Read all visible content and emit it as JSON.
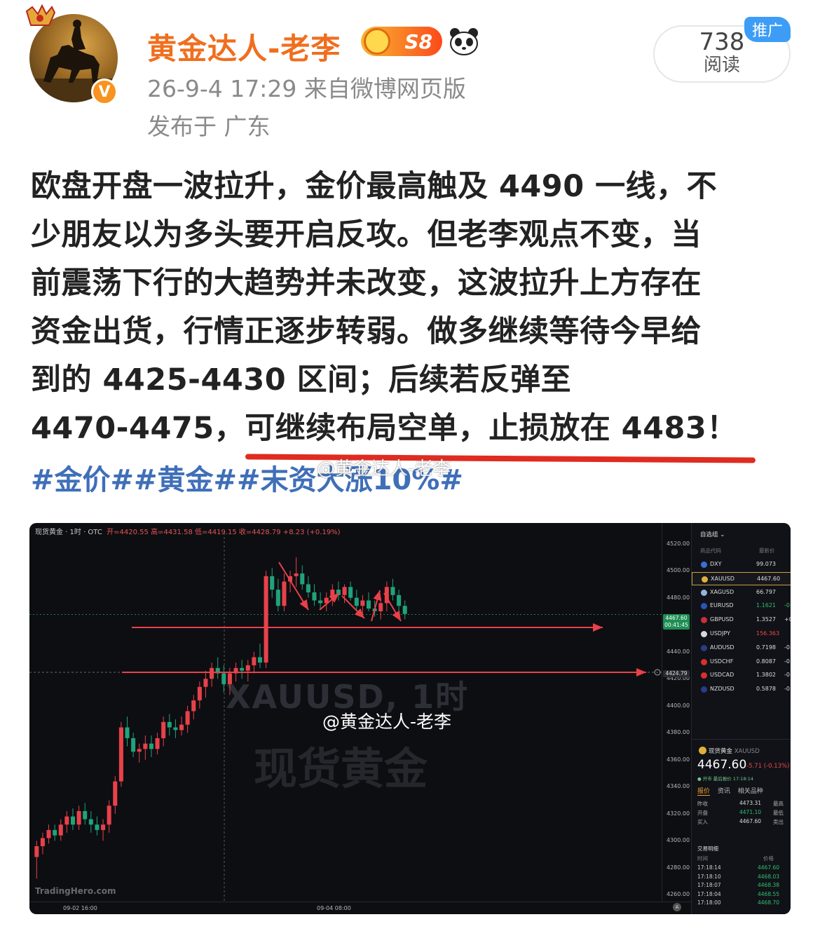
{
  "author": {
    "name": "黄金达人-老李",
    "badge_level": "S8",
    "verified_mark": "V"
  },
  "post_meta": {
    "time_source": "26-9-4 17:29  来自微博网页版",
    "location": "发布于 广东"
  },
  "stats": {
    "reads_count": "738",
    "reads_label": "阅读",
    "promo_label": "推广"
  },
  "post": {
    "lines": [
      "欧盘开盘一波拉升，金价最高触及 4490 一线，不",
      "少朋友以为多头要开启反攻。但老李观点不变，当",
      "前震荡下行的大趋势并未改变，这波拉升上方存在",
      "资金出货，行情正逐步转弱。做多继续等待今早给",
      "到的 4425-4430 区间；后续若反弹至",
      "4470-4475，可继续布局空单，止损放在 4483！"
    ],
    "hashtags": "#金价##黄金##末资大涨10%#",
    "watermark": "@黄金达人-老李"
  },
  "chart": {
    "header_symbol": "现货黄金 · 1时 · OTC",
    "header_ohlc": "开=4420.55  高=4431.58  低=4419.15  收=4428.79  +8.23 (+0.19%)",
    "yticks": [
      "4520.00",
      "4500.00",
      "4480.00",
      "4440.00",
      "4420.00",
      "4400.00",
      "4380.00",
      "4360.00",
      "4340.00",
      "4320.00",
      "4300.00",
      "4280.00",
      "4260.00"
    ],
    "xticks": [
      "09-02 16:00",
      "09-04 08:00"
    ],
    "price_tag_last": "4467.60",
    "price_tag_time": "00:41:45",
    "price_tag_cross": "4424.79",
    "watermark_symbol": "XAUUSD, 1时",
    "watermark_name": "现货黄金",
    "watermark_user": "@黄金达人-老李",
    "brand": "TradingHero.com",
    "axis_btn": "A"
  },
  "chart_data": {
    "type": "candlestick",
    "title": "现货黄金 · 1时 · OTC",
    "ylim": [
      4255,
      4525
    ],
    "candles": [
      [
        4288,
        4300,
        4272,
        4296
      ],
      [
        4296,
        4306,
        4290,
        4302
      ],
      [
        4302,
        4312,
        4298,
        4308
      ],
      [
        4308,
        4312,
        4300,
        4304
      ],
      [
        4304,
        4316,
        4300,
        4312
      ],
      [
        4312,
        4322,
        4306,
        4318
      ],
      [
        4318,
        4324,
        4308,
        4312
      ],
      [
        4312,
        4326,
        4308,
        4322
      ],
      [
        4322,
        4328,
        4312,
        4316
      ],
      [
        4316,
        4322,
        4306,
        4312
      ],
      [
        4312,
        4318,
        4304,
        4308
      ],
      [
        4308,
        4316,
        4300,
        4312
      ],
      [
        4312,
        4330,
        4306,
        4326
      ],
      [
        4326,
        4348,
        4320,
        4344
      ],
      [
        4344,
        4388,
        4340,
        4384
      ],
      [
        4384,
        4392,
        4370,
        4376
      ],
      [
        4376,
        4380,
        4362,
        4366
      ],
      [
        4366,
        4372,
        4358,
        4368
      ],
      [
        4368,
        4378,
        4360,
        4372
      ],
      [
        4372,
        4378,
        4362,
        4368
      ],
      [
        4368,
        4380,
        4364,
        4376
      ],
      [
        4376,
        4392,
        4370,
        4388
      ],
      [
        4388,
        4394,
        4378,
        4384
      ],
      [
        4384,
        4390,
        4376,
        4382
      ],
      [
        4382,
        4392,
        4378,
        4386
      ],
      [
        4386,
        4400,
        4380,
        4396
      ],
      [
        4396,
        4408,
        4390,
        4404
      ],
      [
        4404,
        4418,
        4398,
        4414
      ],
      [
        4414,
        4426,
        4406,
        4420
      ],
      [
        4420,
        4432,
        4414,
        4428
      ],
      [
        4428,
        4436,
        4420,
        4424
      ],
      [
        4424,
        4430,
        4410,
        4416
      ],
      [
        4416,
        4428,
        4408,
        4424
      ],
      [
        4424,
        4432,
        4418,
        4428
      ],
      [
        4428,
        4434,
        4420,
        4426
      ],
      [
        4426,
        4434,
        4418,
        4430
      ],
      [
        4430,
        4440,
        4424,
        4436
      ],
      [
        4436,
        4446,
        4428,
        4432
      ],
      [
        4432,
        4500,
        4428,
        4496
      ],
      [
        4496,
        4502,
        4480,
        4486
      ],
      [
        4486,
        4494,
        4470,
        4474
      ],
      [
        4474,
        4498,
        4470,
        4492
      ],
      [
        4492,
        4500,
        4484,
        4496
      ],
      [
        4496,
        4510,
        4488,
        4498
      ],
      [
        4498,
        4504,
        4486,
        4490
      ],
      [
        4490,
        4496,
        4480,
        4484
      ],
      [
        4484,
        4490,
        4474,
        4478
      ],
      [
        4478,
        4484,
        4472,
        4476
      ],
      [
        4476,
        4484,
        4470,
        4480
      ],
      [
        4480,
        4490,
        4474,
        4486
      ],
      [
        4486,
        4492,
        4478,
        4482
      ],
      [
        4482,
        4490,
        4476,
        4488
      ],
      [
        4488,
        4492,
        4478,
        4480
      ],
      [
        4480,
        4486,
        4470,
        4474
      ],
      [
        4474,
        4482,
        4466,
        4478
      ],
      [
        4478,
        4484,
        4470,
        4472
      ],
      [
        4472,
        4478,
        4466,
        4470
      ],
      [
        4470,
        4480,
        4464,
        4476
      ],
      [
        4476,
        4492,
        4470,
        4488
      ],
      [
        4488,
        4494,
        4478,
        4482
      ],
      [
        4482,
        4486,
        4470,
        4474
      ],
      [
        4474,
        4478,
        4464,
        4468
      ]
    ],
    "levels": [
      4458,
      4424.79
    ],
    "last_price": 4467.6
  },
  "watchlist": {
    "title": "自选组",
    "col_code": "商品代码",
    "col_price": "最新价",
    "rows": [
      {
        "sym": "DXY",
        "price": "99.073",
        "chg": "",
        "dir": "wh",
        "flag": "#3b6fd8"
      },
      {
        "sym": "XAUUSD",
        "price": "4467.60",
        "chg": "",
        "dir": "wh",
        "flag": "#e0b03a",
        "selected": true
      },
      {
        "sym": "XAGUSD",
        "price": "66.797",
        "chg": "",
        "dir": "wh",
        "flag": "#8fb8d8"
      },
      {
        "sym": "EURUSD",
        "price": "1.1621",
        "chg": "-0",
        "dir": "up",
        "flag": "#2a54b8"
      },
      {
        "sym": "GBPUSD",
        "price": "1.3527",
        "chg": "+0",
        "dir": "wh",
        "flag": "#c8303a"
      },
      {
        "sym": "USDJPY",
        "price": "156.363",
        "chg": "",
        "dir": "dn",
        "flag": "#d8d8e0"
      },
      {
        "sym": "AUDUSD",
        "price": "0.7198",
        "chg": "-0",
        "dir": "wh",
        "flag": "#283c8c"
      },
      {
        "sym": "USDCHF",
        "price": "0.8087",
        "chg": "-0",
        "dir": "wh",
        "flag": "#d83030"
      },
      {
        "sym": "USDCAD",
        "price": "1.3802",
        "chg": "-0",
        "dir": "wh",
        "flag": "#d83030"
      },
      {
        "sym": "NZDUSD",
        "price": "0.5878",
        "chg": "-0",
        "dir": "wh",
        "flag": "#283c8c"
      }
    ]
  },
  "quote": {
    "name": "现货黄金",
    "code": "XAUUSD",
    "price": "4467.60",
    "change": "-5.71 (-0.13%)",
    "status": "● 开市 最后报价 17:18:14",
    "tabs": [
      "报价",
      "资讯",
      "相关品种"
    ],
    "rows": [
      {
        "k": "昨收",
        "v": "4473.31",
        "k2": "最高"
      },
      {
        "k": "开盘",
        "v": "4471.10",
        "k2": "最低"
      },
      {
        "k": "买入",
        "v": "4467.60",
        "k2": "卖出"
      }
    ],
    "trades_title": "交易明细",
    "trades_col_time": "时间",
    "trades_col_price": "价格",
    "trades": [
      {
        "t": "17:18:14",
        "p": "4467.60"
      },
      {
        "t": "17:18:10",
        "p": "4468.03"
      },
      {
        "t": "17:18:07",
        "p": "4468.38"
      },
      {
        "t": "17:18:04",
        "p": "4468.55"
      },
      {
        "t": "17:18:00",
        "p": "4468.70"
      }
    ]
  }
}
